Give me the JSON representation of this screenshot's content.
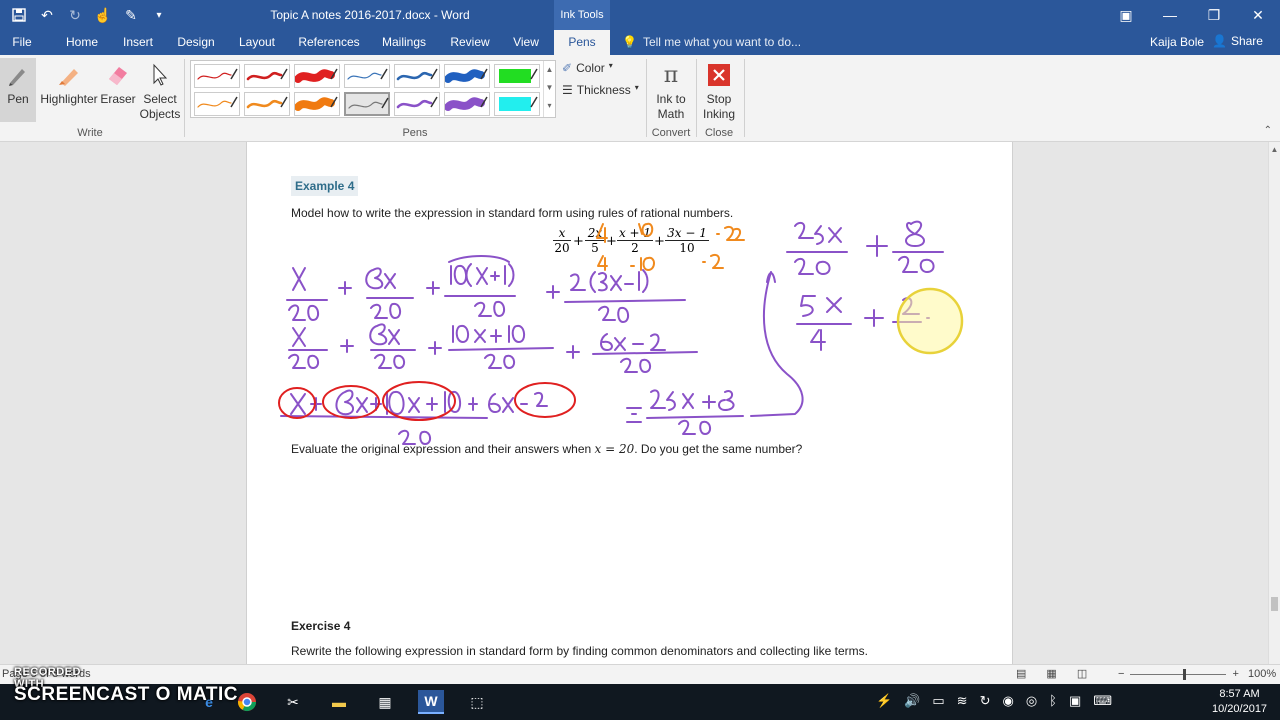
{
  "titlebar": {
    "document_title": "Topic A notes 2016-2017.docx - Word",
    "context_tab": "Ink Tools",
    "qat": [
      "save-icon",
      "undo-icon",
      "redo-icon",
      "touch-mode-icon",
      "pen-icon",
      "customize-icon"
    ],
    "window_controls": [
      "ribbon-display-icon",
      "minimize-icon",
      "restore-icon",
      "close-icon"
    ]
  },
  "tabs": [
    "File",
    "Home",
    "Insert",
    "Design",
    "Layout",
    "References",
    "Mailings",
    "Review",
    "View",
    "Pens"
  ],
  "active_tab": "Pens",
  "tell_me": "Tell me what you want to do...",
  "user_name": "Kaija Bole",
  "share_label": "Share",
  "ribbon": {
    "write": {
      "label": "Write",
      "buttons": [
        {
          "label": "Pen",
          "icon": "pen-icon"
        },
        {
          "label": "Highlighter",
          "icon": "highlighter-icon"
        },
        {
          "label": "Eraser",
          "icon": "eraser-icon"
        },
        {
          "label": "Select Objects",
          "icon": "cursor-icon"
        }
      ]
    },
    "pens": {
      "label": "Pens",
      "color_label": "Color",
      "thickness_label": "Thickness",
      "row1_colors": [
        "#d01f1f",
        "#d01f1f",
        "#e02020",
        "#3a74b8",
        "#2b66b0",
        "#2060c0",
        "#22dd22"
      ],
      "row2_colors": [
        "#f08a1e",
        "#f08a1e",
        "#f07a10",
        "#777777",
        "#8a52c8",
        "#8a52c8",
        "#22eeee"
      ]
    },
    "convert": {
      "label": "Convert",
      "button": "Ink to Math"
    },
    "close": {
      "label": "Close",
      "button": "Stop Inking"
    }
  },
  "document": {
    "example_label": "Example 4",
    "instruction": "Model how to write the expression in standard form using rules of rational numbers.",
    "expression": {
      "terms": [
        {
          "num": "x",
          "den": "20"
        },
        {
          "num": "2x",
          "den": "5"
        },
        {
          "num": "x + 1",
          "den": "2"
        },
        {
          "num": "3x − 1",
          "den": "10"
        }
      ],
      "ops": [
        "+",
        "+",
        "+"
      ]
    },
    "evaluate_question_a": "Evaluate the original expression and their answers when ",
    "evaluate_var": "x = 20",
    "evaluate_question_b": ".  Do you get the same number?",
    "exercise_label": "Exercise 4",
    "exercise_text": "Rewrite the following expression in standard form by finding common denominators and collecting like terms."
  },
  "statusbar": {
    "words_label": "Page 5 of 8    words",
    "zoom": "100%",
    "zoom_level": 1.0
  },
  "taskbar": {
    "watermark_top": "RECORDED WITH",
    "watermark_brand": "SCREENCAST O MATIC",
    "time": "8:57 AM",
    "date": "10/20/2017"
  }
}
